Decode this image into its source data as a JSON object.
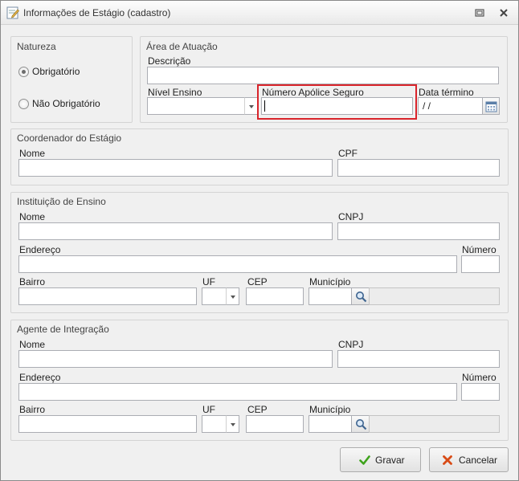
{
  "window": {
    "title": "Informações de Estágio (cadastro)",
    "icons": {
      "app": "form-edit-icon",
      "restore": "restore-icon",
      "close": "close-icon"
    }
  },
  "natureza": {
    "title": "Natureza",
    "options": [
      {
        "label": "Obrigatório",
        "selected": true
      },
      {
        "label": "Não Obrigatório",
        "selected": false
      }
    ]
  },
  "area": {
    "title": "Área de Atuação",
    "descricao_label": "Descrição",
    "descricao_value": "",
    "nivel_label": "Nível Ensino",
    "nivel_value": "",
    "apolice_label": "Número Apólice Seguro",
    "apolice_value": "",
    "data_label": "Data término",
    "data_value": " / /"
  },
  "coordenador": {
    "title": "Coordenador do Estágio",
    "nome_label": "Nome",
    "cpf_label": "CPF"
  },
  "instituicao": {
    "title": "Instituição de Ensino",
    "nome_label": "Nome",
    "cnpj_label": "CNPJ",
    "endereco_label": "Endereço",
    "numero_label": "Número",
    "bairro_label": "Bairro",
    "uf_label": "UF",
    "cep_label": "CEP",
    "municipio_label": "Município"
  },
  "agente": {
    "title": "Agente de Integração",
    "nome_label": "Nome",
    "cnpj_label": "CNPJ",
    "endereco_label": "Endereço",
    "numero_label": "Número",
    "bairro_label": "Bairro",
    "uf_label": "UF",
    "cep_label": "CEP",
    "municipio_label": "Município"
  },
  "buttons": {
    "gravar": "Gravar",
    "cancelar": "Cancelar"
  },
  "colors": {
    "highlight": "#d9242b",
    "gravar_icon": "#3ea31c",
    "cancelar_icon": "#d84b16"
  }
}
